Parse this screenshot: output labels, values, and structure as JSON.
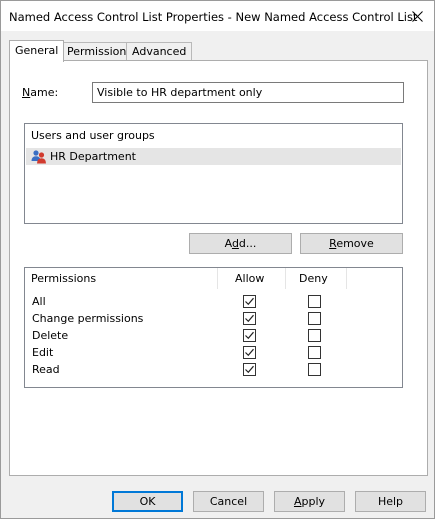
{
  "window": {
    "title": "Named Access Control List Properties - New Named Access Control List",
    "close_icon": "close-icon"
  },
  "tabs": [
    {
      "label": "General",
      "active": true
    },
    {
      "label": "Permissions",
      "active": false
    },
    {
      "label": "Advanced",
      "active": false
    }
  ],
  "general": {
    "name_label_prefix": "N",
    "name_label_rest": "ame:",
    "name_value": "Visible to HR department only",
    "users_header": "Users and user groups",
    "users": [
      {
        "label": "HR Department",
        "icon": "user-group-icon",
        "selected": true
      }
    ],
    "add_label_prefix": "A",
    "add_label_mid": "d",
    "add_label_rest": "d...",
    "remove_label_prefix": "R",
    "remove_label_rest": "emove",
    "permissions": {
      "col_permission": "Permissions",
      "col_allow": "Allow",
      "col_deny": "Deny",
      "rows": [
        {
          "name": "All",
          "allow": true,
          "deny": false
        },
        {
          "name": "Change permissions",
          "allow": true,
          "deny": false
        },
        {
          "name": "Delete",
          "allow": true,
          "deny": false
        },
        {
          "name": "Edit",
          "allow": true,
          "deny": false
        },
        {
          "name": "Read",
          "allow": true,
          "deny": false
        }
      ]
    }
  },
  "footer": {
    "ok": "OK",
    "cancel": "Cancel",
    "apply_prefix": "A",
    "apply_rest": "pply",
    "help": "Help"
  }
}
